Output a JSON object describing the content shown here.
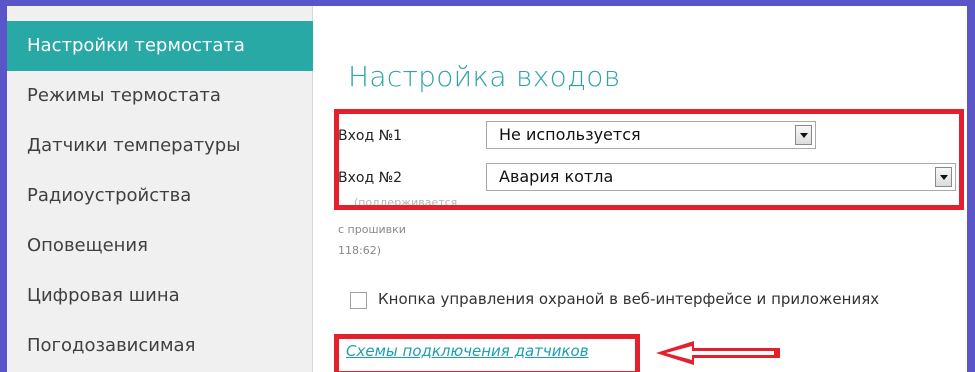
{
  "sidebar": {
    "items": [
      {
        "label": "Настройки термостата"
      },
      {
        "label": "Режимы термостата"
      },
      {
        "label": "Датчики температуры"
      },
      {
        "label": "Радиоустройства"
      },
      {
        "label": "Оповещения"
      },
      {
        "label": "Цифровая шина"
      },
      {
        "label": "Погодозависимая"
      }
    ]
  },
  "main": {
    "title": "Настройка входов",
    "input1": {
      "label": "Вход №1",
      "value": "Не используется"
    },
    "input2": {
      "label": "Вход №2",
      "value": "Авария котла"
    },
    "hint_line1": "(поддерживается",
    "hint_line2": "с прошивки",
    "hint_line3": "118:62)",
    "security_checkbox": {
      "label": "Кнопка управления охраной в веб-интерфейсе и приложениях",
      "checked": false
    },
    "schemes_link": "Схемы подключения датчиков"
  },
  "colors": {
    "accent": "#29a9a6",
    "highlight": "#e3202c",
    "frame": "#5a55c9",
    "link": "#1a9fb0"
  },
  "icons": {
    "annotation_arrow": "left-arrow-icon",
    "dropdown": "chevron-down-icon"
  }
}
